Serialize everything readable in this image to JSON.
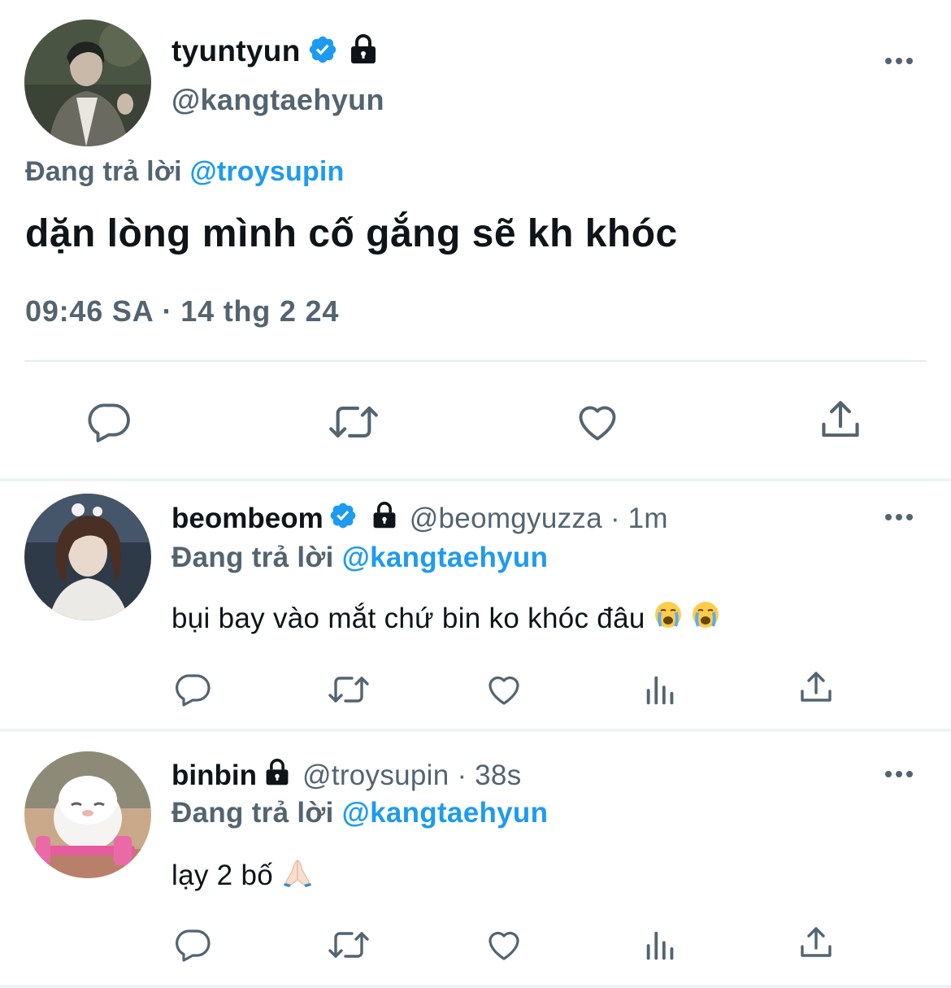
{
  "main_tweet": {
    "display_name": "tyuntyun",
    "handle": "@kangtaehyun",
    "replying_prefix": "Đang trả lời",
    "replying_to": "@troysupin",
    "text": "dặn lòng mình cố gắng sẽ kh khóc",
    "time": "09:46 SA",
    "separator": "·",
    "date": "14 thg 2 24",
    "verified": true,
    "protected": true
  },
  "replies": [
    {
      "display_name": "beombeom",
      "handle": "@beomgyuzza",
      "separator": "·",
      "time": "1m",
      "replying_prefix": "Đang trả lời",
      "replying_to": "@kangtaehyun",
      "text": "bụi bay vào mắt chứ bin ko khóc đâu",
      "emoji": [
        "loudly-crying-face",
        "loudly-crying-face"
      ],
      "verified": true,
      "protected": true
    },
    {
      "display_name": "binbin",
      "handle": "@troysupin",
      "separator": "·",
      "time": "38s",
      "replying_prefix": "Đang trả lời",
      "replying_to": "@kangtaehyun",
      "text": "lạy 2 bố",
      "emoji": [
        "folded-hands"
      ],
      "verified": false,
      "protected": true
    }
  ],
  "icons": {
    "main_actions": [
      "reply-icon",
      "retweet-icon",
      "like-icon",
      "share-icon"
    ],
    "reply_actions": [
      "reply-icon",
      "retweet-icon",
      "like-icon",
      "views-icon",
      "share-icon"
    ],
    "more": "more-options-icon",
    "verified": "verified-badge-icon",
    "protected": "lock-icon"
  },
  "colors": {
    "text_primary": "#0f1419",
    "text_secondary": "#536471",
    "accent": "#1d9bf0",
    "divider": "#eff3f4"
  }
}
